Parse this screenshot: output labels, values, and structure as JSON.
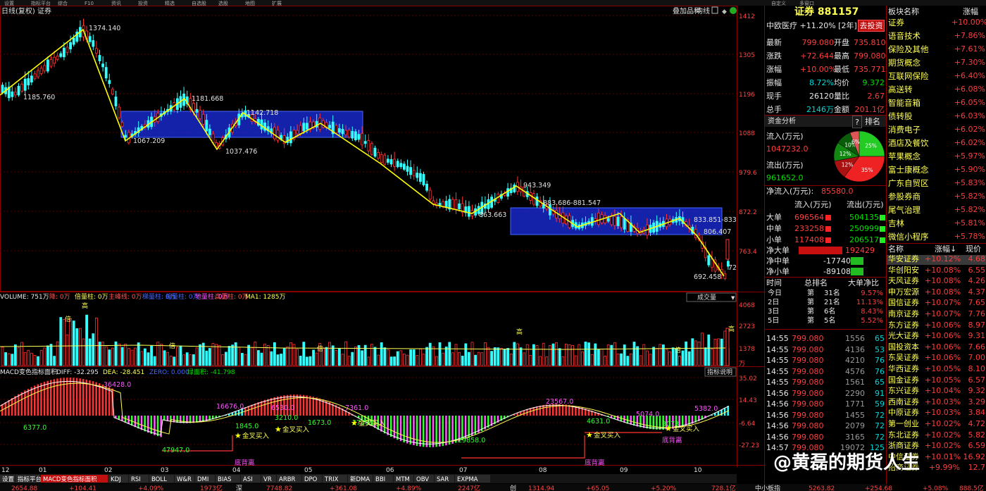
{
  "top_menu": [
    "设置",
    "指标平台",
    "综合",
    "F10",
    "资讯",
    "投资",
    "精选",
    "自选股",
    "选股",
    "地图",
    "扩展"
  ],
  "top_right_menu": [
    "自定义",
    "多窗口"
  ],
  "chart_header": {
    "title": "日线(复权) 证券",
    "buttons": [
      "叠加品种",
      "均线",
      "前复权"
    ]
  },
  "price_axis": [
    "1412",
    "1305",
    "1196",
    "1088",
    "979.6",
    "872.2",
    "763.4"
  ],
  "price_annotations": [
    "1374.140",
    "1185.760",
    "1181.668",
    "1067.209",
    "1142.718",
    "1037.476",
    "943.349",
    "883.686-881.547",
    "863.663",
    "833.851-833",
    "806.407",
    "692.458",
    "72"
  ],
  "volume_panel": {
    "label": "VOLUME: 751万",
    "ind1": "降: 0万",
    "ind2": "倍量柱: 0万",
    "ind3": "主峰线: 0万",
    "ind4": "梯量柱: 0万",
    "ind5": "缩量柱: 0万",
    "ind6": "地量柱: 0万",
    "ind7": "高量柱: 0万",
    "ma": "MA1: 1285万",
    "dropdown": "成交量",
    "axis": [
      "4068",
      "2723",
      "1378",
      "万"
    ],
    "markers": [
      "高",
      "倍",
      "高",
      "倍",
      "倍",
      "倍",
      "高"
    ]
  },
  "macd_panel": {
    "label": "MACD变色指标面积",
    "diff": "DIFF: -32.295",
    "dea": "DEA: -28.451",
    "zero": "ZERO: 0.000",
    "area": "绿面积: -41.798",
    "help": "指标说明",
    "axis": [
      "35.02",
      "14.43",
      "-6.64",
      "-27.23"
    ],
    "values": [
      "36428.0",
      "16676.0",
      "6530.0",
      "7361.0",
      "23567.0",
      "5074.0",
      "5382.0",
      "6377.0",
      "1845.0",
      "3210.0",
      "1673.0",
      "2730.0",
      "4631.0",
      "3073",
      "47947.0",
      "29858.0"
    ],
    "signals": [
      "金叉买入",
      "金叉买入",
      "金叉买入",
      "金叉买入",
      "金叉买入"
    ],
    "divergence": [
      "底背离",
      "底背离",
      "底背离"
    ]
  },
  "x_axis": [
    "12",
    "01",
    "02",
    "03",
    "04",
    "05",
    "06",
    "07",
    "08",
    "09",
    "10"
  ],
  "indicator_tabs": [
    "设置",
    "指标平台",
    "MACD变色指标面积",
    "KDJ",
    "RSI",
    "BOLL",
    "W&R",
    "DMI",
    "BIAS",
    "ASI",
    "VR",
    "ARBR",
    "DPO",
    "TRIX",
    "新DMA",
    "BBI",
    "MTM",
    "OBV",
    "SAR",
    "EXPMA"
  ],
  "bottom_ticker": [
    "2654.88",
    "+104.41",
    "+4.09%",
    "1973亿",
    "深",
    "7748.82",
    "+361.08",
    "+4.89%",
    "2247亿",
    "创",
    "1314.94",
    "+65.05",
    "+5.20%",
    "728.1亿",
    "中小板指",
    "5263.82",
    "+254.68",
    "+5.08%",
    "888.5亿"
  ],
  "quote": {
    "title": "证券 881157",
    "sub": "中欧医疗 +11.20% [2年]",
    "action": "去投资",
    "rows": [
      {
        "k1": "最新",
        "v1": "799.080",
        "k2": "开盘",
        "v2": "735.810"
      },
      {
        "k1": "涨跌",
        "v1": "+72.644",
        "k2": "最高",
        "v2": "799.080"
      },
      {
        "k1": "涨幅",
        "v1": "+10.00%",
        "k2": "最低",
        "v2": "735.771"
      },
      {
        "k1": "振幅",
        "v1": "8.72%",
        "k2": "均价",
        "v2": "9.372"
      },
      {
        "k1": "现手",
        "v1": "26120",
        "k2": "量比",
        "v2": "2.67"
      },
      {
        "k1": "总手",
        "v1": "2146万",
        "k2": "金额",
        "v2": "201.1亿"
      }
    ]
  },
  "fund": {
    "title": "资金分析",
    "q": "?",
    "rank": "排名",
    "in_label": "流入(万元)",
    "in_value": "1047232.0",
    "out_label": "流出(万元)",
    "out_value": "961652.0",
    "net_label": "净流入(万元):",
    "net_value": "85580.0",
    "pie": [
      {
        "label": "25%",
        "value": 25,
        "color": "#22cc22"
      },
      {
        "label": "35%",
        "value": 35,
        "color": "#ee2222"
      },
      {
        "label": "12%",
        "value": 12,
        "color": "#aa1111"
      },
      {
        "label": "12%",
        "value": 12,
        "color": "#118811"
      },
      {
        "label": "10%",
        "value": 10,
        "color": "#0a5c0a"
      },
      {
        "label": "6%",
        "value": 6,
        "color": "#dd5555"
      }
    ],
    "table_head": [
      "流入(万元)",
      "流出(万元)"
    ],
    "table": [
      {
        "name": "大单",
        "in": "696564",
        "out": "504135"
      },
      {
        "name": "中单",
        "in": "233258",
        "out": "250999"
      },
      {
        "name": "小单",
        "in": "117408",
        "out": "206517"
      }
    ],
    "net_rows": [
      {
        "name": "净大单",
        "value": "192429",
        "dir": "pos"
      },
      {
        "name": "净中单",
        "value": "-17740",
        "dir": "neg"
      },
      {
        "name": "净小单",
        "value": "-89108",
        "dir": "neg"
      }
    ],
    "rank_head": [
      "时间",
      "总排名",
      "大单净比"
    ],
    "rank_rows": [
      {
        "t": "今日",
        "r": "第",
        "n": "31名",
        "p": "9.57%"
      },
      {
        "t": "2日",
        "r": "第",
        "n": "21名",
        "p": "11.13%"
      },
      {
        "t": "3日",
        "r": "第",
        "n": "6名",
        "p": "8.43%"
      },
      {
        "t": "5日",
        "r": "第",
        "n": "5名",
        "p": "5.52%"
      }
    ]
  },
  "ticks": [
    {
      "t": "14:55",
      "p": "799.080",
      "v": "1556",
      "n": "65"
    },
    {
      "t": "14:55",
      "p": "799.080",
      "v": "4136",
      "n": "53"
    },
    {
      "t": "14:55",
      "p": "799.080",
      "v": "4210",
      "n": "76"
    },
    {
      "t": "14:55",
      "p": "799.080",
      "v": "4576",
      "n": "76"
    },
    {
      "t": "14:55",
      "p": "799.080",
      "v": "1561",
      "n": "65"
    },
    {
      "t": "14:56",
      "p": "799.080",
      "v": "2290",
      "n": "91"
    },
    {
      "t": "14:56",
      "p": "799.080",
      "v": "1771",
      "n": "59"
    },
    {
      "t": "14:56",
      "p": "799.080",
      "v": "1455",
      "n": "72"
    },
    {
      "t": "14:56",
      "p": "799.080",
      "v": "2079",
      "n": "72"
    },
    {
      "t": "14:56",
      "p": "799.080",
      "v": "3165",
      "n": "72"
    },
    {
      "t": "14:57",
      "p": "799.080",
      "v": "19072",
      "n": "125"
    }
  ],
  "sectors": {
    "head": [
      "板块名称",
      "涨幅"
    ],
    "items": [
      {
        "name": "证券",
        "pct": "+10.00%"
      },
      {
        "name": "语音技术",
        "pct": "+7.86%"
      },
      {
        "name": "保险及其他",
        "pct": "+7.61%"
      },
      {
        "name": "期货概念",
        "pct": "+7.30%"
      },
      {
        "name": "互联网保险",
        "pct": "+6.40%"
      },
      {
        "name": "高送转",
        "pct": "+6.08%"
      },
      {
        "name": "智能音箱",
        "pct": "+6.05%"
      },
      {
        "name": "债转股",
        "pct": "+6.03%"
      },
      {
        "name": "消费电子",
        "pct": "+6.02%"
      },
      {
        "name": "酒店及餐饮",
        "pct": "+6.02%"
      },
      {
        "name": "苹果概念",
        "pct": "+5.97%"
      },
      {
        "name": "富士康概念",
        "pct": "+5.90%"
      },
      {
        "name": "广东自贸区",
        "pct": "+5.83%"
      },
      {
        "name": "参股券商",
        "pct": "+5.82%"
      },
      {
        "name": "尾气治理",
        "pct": "+5.82%"
      },
      {
        "name": "吉林",
        "pct": "+5.81%"
      },
      {
        "name": "微信小程序",
        "pct": "+5.78%"
      }
    ]
  },
  "stocks": {
    "head": [
      "名称",
      "涨幅↓",
      "现价"
    ],
    "items": [
      {
        "name": "华安证券",
        "pct": "+10.12%",
        "price": "4.68"
      },
      {
        "name": "华创阳安",
        "pct": "+10.08%",
        "price": "6.55"
      },
      {
        "name": "天风证券",
        "pct": "+10.08%",
        "price": "4.26"
      },
      {
        "name": "申万宏源",
        "pct": "+10.08%",
        "price": "4.37"
      },
      {
        "name": "国信证券",
        "pct": "+10.07%",
        "price": "7.65"
      },
      {
        "name": "南京证券",
        "pct": "+10.07%",
        "price": "7.76"
      },
      {
        "name": "东方证券",
        "pct": "+10.06%",
        "price": "8.97"
      },
      {
        "name": "光大证券",
        "pct": "+10.06%",
        "price": "9.31"
      },
      {
        "name": "国投资本",
        "pct": "+10.06%",
        "price": "7.66"
      },
      {
        "name": "东吴证券",
        "pct": "+10.06%",
        "price": "7.00"
      },
      {
        "name": "华西证券",
        "pct": "+10.05%",
        "price": "8.10"
      },
      {
        "name": "国金证券",
        "pct": "+10.05%",
        "price": "6.57"
      },
      {
        "name": "东兴证券",
        "pct": "+10.04%",
        "price": "9.32"
      },
      {
        "name": "西南证券",
        "pct": "+10.03%",
        "price": "3.29"
      },
      {
        "name": "中原证券",
        "pct": "+10.03%",
        "price": "3.84"
      },
      {
        "name": "第一创业",
        "pct": "+10.02%",
        "price": "4.72"
      },
      {
        "name": "东北证券",
        "pct": "+10.02%",
        "price": "5.82"
      },
      {
        "name": "浙商证券",
        "pct": "+10.02%",
        "price": "6.59"
      },
      {
        "name": "中信证券",
        "pct": "+10.01%",
        "price": "16.92"
      },
      {
        "name": "招商证券",
        "pct": "+9.99%",
        "price": "12.7"
      }
    ]
  },
  "watermark": "@黄磊的期货人生"
}
